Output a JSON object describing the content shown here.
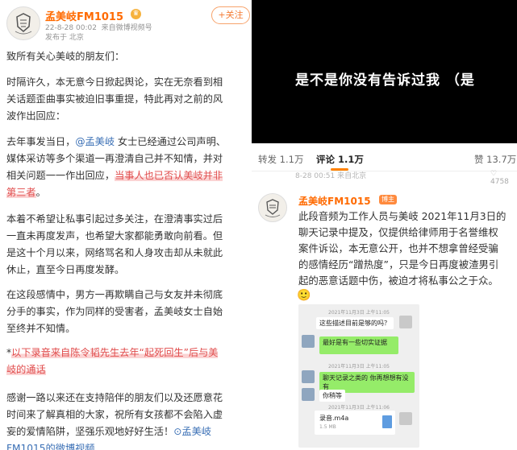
{
  "left_post": {
    "author": "孟美岐FM1015",
    "timestamp": "22-8-28 00:02",
    "source": "来自微博视频号",
    "location": "发布于 北京",
    "follow_label": "+关注",
    "greeting": "致所有关心美岐的朋友们：",
    "para2_lines": [
      "时隔许久，本无意今日掀起舆论，实在无奈看到相",
      "关话题歪曲事实被迫旧事重提，特此再对之前的风",
      "波作出回应："
    ],
    "para3_line1_a": "去年事发当日，",
    "para3_line1_mention": "@孟美岐",
    "para3_line1_b": " 女士已经通过公司声明、",
    "para3_line2": "媒体采访等多个渠道一再澄清自己并不知情，并对",
    "para3_line3_a": "相关问题一一作出回应，",
    "para3_line3_hl": "当事人也已否认美岐并非",
    "para3_line4_hl": "第三者",
    "para3_line4_b": "。",
    "para4_lines": [
      "本着不希望让私事引起过多关注，在澄清事实过后",
      "一直未再度发声，也希望大家都能勇敢向前看。但",
      "是这十个月以来，网络骂名和人身攻击却从未就此",
      "休止，直至今日再度发酵。"
    ],
    "para5_lines": [
      "在这段感情中，男方一再欺瞒自己与女友并未彻底",
      "分手的事实，作为同样的受害者，孟美岐女士自始",
      "至终并不知情。"
    ],
    "para6_star": "*",
    "para6_line1_hl": "以下录音来自陈令韬先生去年“起死回生”后与美",
    "para6_line2_hl": "岐的通话",
    "para7_lines": [
      "感谢一路以来还在支持陪伴的朋友们以及还愿意花",
      "时间来了解真相的大家，祝所有女孩都不会陷入虚"
    ],
    "para7_line3_a": "妄的爱情陷阱，坚强乐观地好好生活！",
    "para7_line3_link": "孟美岐",
    "para7_line4_link": "FM1015的微博视频"
  },
  "video": {
    "subtitle": "是不是你没有告诉过我 （是"
  },
  "action_bar": {
    "repost": "转发 1.1万",
    "comment": "评论 1.1万",
    "like": "赞 13.7万"
  },
  "peek_row": {
    "date": "8-28 00:51 来自北京",
    "count": "4758"
  },
  "reply": {
    "author": "孟美岐FM1015",
    "badge": "博主",
    "lines": [
      "此段音频为工作人员与美岐 2021年11月3日的",
      "聊天记录中提及，仅提供给律师用于名誉维权",
      "案件诉讼，本无意公开，也并不想拿曾经受骗",
      "的感情经历“蹭热度”，只是今日再度被渣男引",
      "起的恶意话题中伤，被迫才将私事公之于众。"
    ],
    "emoji": "🙂"
  },
  "chat_screenshot": {
    "time1": "2021年11月3日 上午11:05",
    "msg1": "这些描述目前是够的吗？",
    "msg2": "最好是有一些切实证据",
    "time2": "2021年11月3日 上午11:05",
    "msg3": "聊天记录之类的 你再想想有没有",
    "msg4": "你稍等",
    "time3": "2021年11月3日 上午11:06",
    "file_name": "录音.m4a",
    "file_size": "1.5 MB"
  },
  "colors": {
    "accent": "#ff8200",
    "name": "#ff6a00",
    "highlight_text": "#e04a4a",
    "link": "#3a6fb5",
    "wechat_green": "#95ec69"
  }
}
